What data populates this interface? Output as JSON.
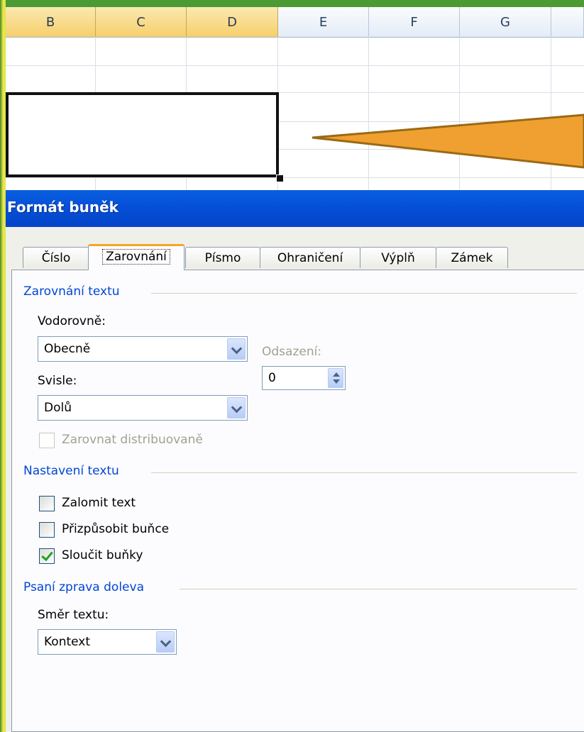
{
  "sheet": {
    "columns": [
      {
        "label": "B",
        "selected": true
      },
      {
        "label": "C",
        "selected": true
      },
      {
        "label": "D",
        "selected": true
      },
      {
        "label": "E",
        "selected": false
      },
      {
        "label": "F",
        "selected": false
      },
      {
        "label": "G",
        "selected": false
      },
      {
        "label": "",
        "selected": false
      }
    ]
  },
  "dialog": {
    "title": "Formát buněk",
    "tabs": [
      "Číslo",
      "Zarovnání",
      "Písmo",
      "Ohraničení",
      "Výplň",
      "Zámek"
    ],
    "active_tab": "Zarovnání",
    "text_alignment": {
      "heading": "Zarovnání textu",
      "horizontal_label": "Vodorovně:",
      "horizontal_value": "Obecně",
      "indent_label": "Odsazení:",
      "indent_value": "0",
      "vertical_label": "Svisle:",
      "vertical_value": "Dolů",
      "distributed_label": "Zarovnat distribuovaně"
    },
    "text_control": {
      "heading": "Nastavení textu",
      "wrap_text": {
        "label": "Zalomit text",
        "checked": false
      },
      "shrink_to_fit": {
        "label": "Přizpůsobit buňce",
        "checked": false
      },
      "merge_cells": {
        "label": "Sloučit buňky",
        "checked": true
      }
    },
    "right_to_left": {
      "heading": "Psaní zprava doleva",
      "direction_label": "Směr textu:",
      "direction_value": "Kontext"
    }
  },
  "colors": {
    "title_bar": "#0550d8",
    "group_heading": "#0046d5",
    "callout_fill": "#f0a030",
    "selected_header": "#f6cf6a"
  }
}
